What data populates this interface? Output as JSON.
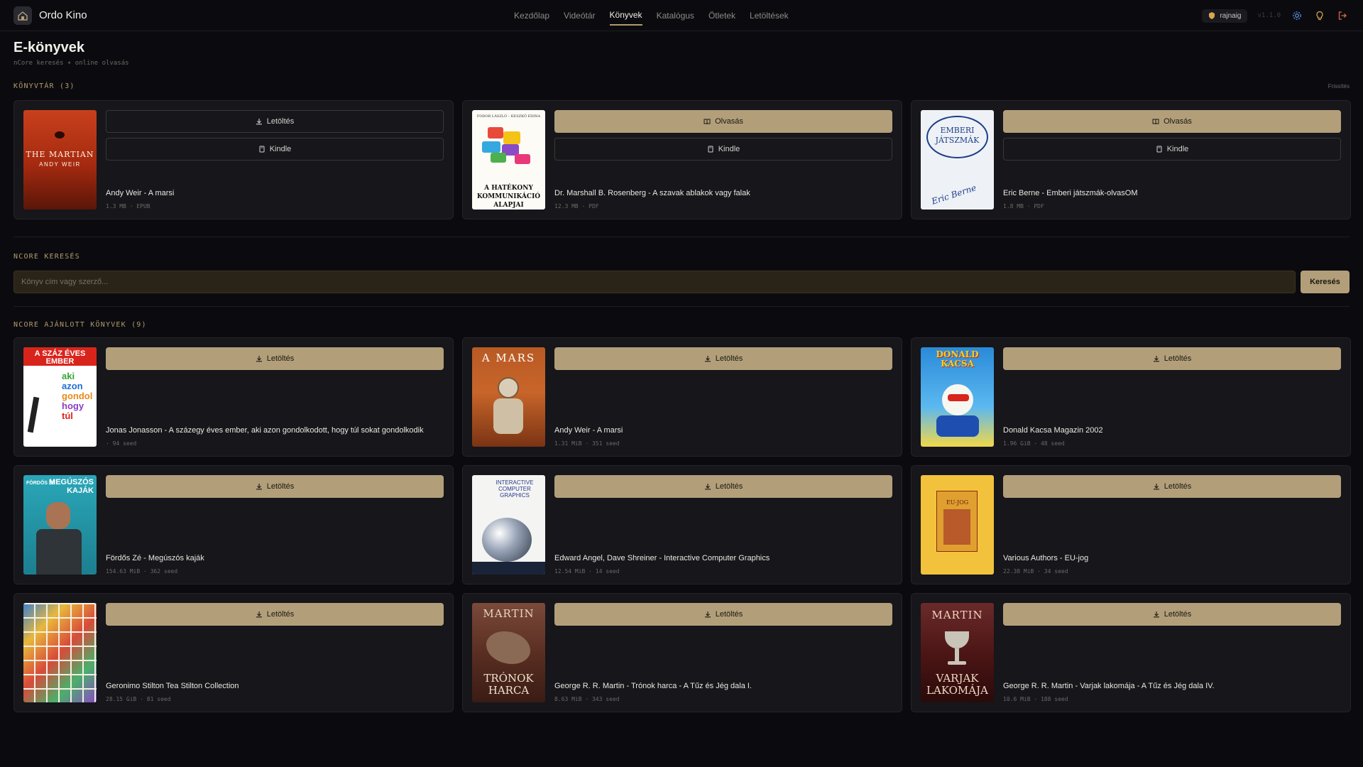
{
  "app": {
    "name": "Ordo Kino"
  },
  "nav": [
    {
      "label": "Kezdőlap",
      "active": false
    },
    {
      "label": "Videótár",
      "active": false
    },
    {
      "label": "Könyvek",
      "active": true
    },
    {
      "label": "Katalógus",
      "active": false
    },
    {
      "label": "Ötletek",
      "active": false
    },
    {
      "label": "Letöltések",
      "active": false
    }
  ],
  "user": {
    "name": "rajnaig",
    "version": "v1.1.0"
  },
  "page": {
    "title": "E-könyvek",
    "subtitle": "nCore keresés + online olvasás"
  },
  "library": {
    "title": "KÖNYVTÁR (3)",
    "refresh_label": "Frissítés",
    "books": [
      {
        "title": "Andy Weir - A marsi",
        "meta": "1.3 MB · EPUB",
        "primary": "Letöltés",
        "secondary": "Kindle",
        "primary_style": "outline",
        "cover_text": "THE MARTIAN",
        "cover_author": "ANDY WEIR"
      },
      {
        "title": "Dr. Marshall B. Rosenberg - A szavak ablakok vagy falak",
        "meta": "12.3 MB · PDF",
        "primary": "Olvasás",
        "secondary": "Kindle",
        "primary_style": "gold",
        "cover_text": "A HATÉKONY KOMMUNIKÁCIÓ ALAPJAI",
        "cover_author": "FODOR LÁSZLÓ – KESZKŐ EDINA"
      },
      {
        "title": "Eric Berne - Emberi játszmák-olvasOM",
        "meta": "1.8 MB · PDF",
        "primary": "Olvasás",
        "secondary": "Kindle",
        "primary_style": "gold",
        "cover_text": "EMBERI JÁTSZMÁK",
        "cover_author": "Eric Berne"
      }
    ]
  },
  "search": {
    "title": "NCORE KERESÉS",
    "placeholder": "Könyv cím vagy szerző...",
    "button": "Keresés"
  },
  "recommended": {
    "title": "NCORE AJÁNLOTT KÖNYVEK (9)",
    "button": "Letöltés",
    "books": [
      {
        "title": "Jonas Jonasson - A százegy éves ember, aki azon gondolkodott, hogy túl sokat gondolkodik",
        "meta": "· 94 seed",
        "cover_text": "A SZÁZ ÉVES EMBER",
        "cover_author": ""
      },
      {
        "title": "Andy Weir - A marsi",
        "meta": "1.31 MiB · 351 seed",
        "cover_text": "A MARS",
        "cover_author": ""
      },
      {
        "title": "Donald Kacsa Magazin 2002",
        "meta": "1.96 GiB · 48 seed",
        "cover_text": "DONALD KACSA",
        "cover_author": ""
      },
      {
        "title": "Fördős Zé - Megúszós kaják",
        "meta": "154.63 MiB · 362 seed",
        "cover_text": "MEGÚSZÓS KAJÁK",
        "cover_author": "FÖRDŐS ZÉ"
      },
      {
        "title": "Edward Angel, Dave Shreiner - Interactive Computer Graphics",
        "meta": "12.54 MiB · 14 seed",
        "cover_text": "INTERACTIVE COMPUTER GRAPHICS",
        "cover_author": ""
      },
      {
        "title": "Various Authors - EU-jog",
        "meta": "22.38 MiB · 34 seed",
        "cover_text": "EU-JOG",
        "cover_author": ""
      },
      {
        "title": "Geronimo Stilton Tea Stilton Collection",
        "meta": "28.15 GiB · 81 seed",
        "cover_text": "",
        "cover_author": ""
      },
      {
        "title": "George R. R. Martin - Trónok harca - A Tűz és Jég dala I.",
        "meta": "8.63 MiB · 343 seed",
        "cover_text": "TRÓNOK HARCA",
        "cover_author": "MARTIN"
      },
      {
        "title": "George R. R. Martin - Varjak lakomája - A Tűz és Jég dala IV.",
        "meta": "10.6 MiB · 188 seed",
        "cover_text": "VARJAK LAKOMÁJA",
        "cover_author": "MARTIN"
      }
    ]
  },
  "colors": {
    "accent": "#b29f7a",
    "background": "#0b0b0f",
    "card": "#16161b"
  }
}
